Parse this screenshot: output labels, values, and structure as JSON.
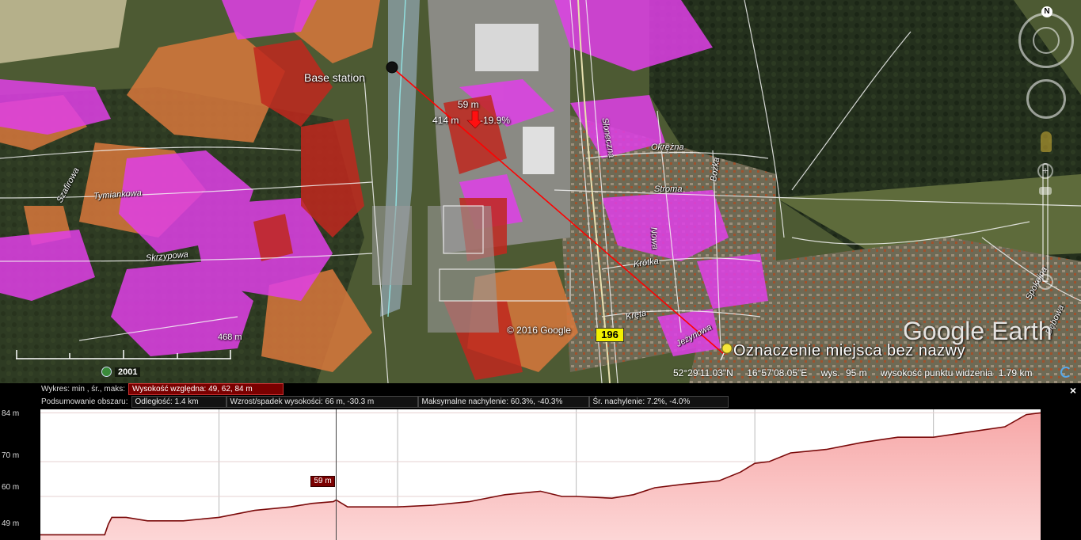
{
  "map": {
    "base_station_label": "Base station",
    "profile_point": {
      "elevation": "59 m",
      "distance": "414 m",
      "slope": "-19.9%"
    },
    "copyright": "© 2016 Google",
    "scale_label": "468 m",
    "placemark_label": "Oznaczenie miejsca bez nazwy",
    "logo": "Google Earth",
    "road_number": "196",
    "imagery_year": "2001",
    "streets": [
      {
        "name": "Szafirowa"
      },
      {
        "name": "Tymiankowa"
      },
      {
        "name": "Skrzypowa"
      },
      {
        "name": "Okrężna"
      },
      {
        "name": "Stroma"
      },
      {
        "name": "Krótka"
      },
      {
        "name": "Kręta"
      },
      {
        "name": "Jeżynowa"
      },
      {
        "name": "Spokojna"
      },
      {
        "name": "Słoneczna"
      },
      {
        "name": "Nowa"
      },
      {
        "name": "Bożka"
      },
      {
        "name": "Dębowa"
      }
    ],
    "status": {
      "latitude": "52°29'11.03\"N",
      "longitude": "16°57'08.05\"E",
      "elevation_label": "wys.",
      "elevation_value": "95 m",
      "eye_alt_label": "wysokość punktu widzenia",
      "eye_alt_value": "1.79 km"
    },
    "nav": {
      "north": "N",
      "zoom_in": "+",
      "zoom_out": "−"
    },
    "colors": {
      "coverage_magenta": "#e040e8",
      "coverage_orange": "#d8783c",
      "coverage_red": "#c0281e",
      "path_line": "#ff0000",
      "placemark": "#f5e53a"
    }
  },
  "profile": {
    "row1_label": "Wykres: min , śr., maks:",
    "row1_highlight": "Wysokość względna: 49, 62, 84 m",
    "row2_label": "Podsumowanie obszaru:",
    "row2_cells": [
      "Odległość: 1.4 km",
      "Wzrost/spadek wysokości: 66 m, -30.3 m",
      "Maksymalne nachylenie: 60.3%, -40.3%",
      "Śr. nachylenie: 7.2%, -4.0%"
    ],
    "close": "×",
    "y_ticks": [
      {
        "label": "84 m",
        "value": 84
      },
      {
        "label": "70 m",
        "value": 70
      },
      {
        "label": "60 m",
        "value": 60
      },
      {
        "label": "49 m",
        "value": 49
      }
    ],
    "cursor": {
      "label": "59 m",
      "distance_km": 0.414
    },
    "chart_data": {
      "type": "area",
      "ylim": [
        47.5,
        85
      ],
      "xlim": [
        0,
        1.4
      ],
      "x": [
        0,
        0.05,
        0.09,
        0.095,
        0.1,
        0.12,
        0.15,
        0.2,
        0.25,
        0.3,
        0.35,
        0.38,
        0.41,
        0.414,
        0.43,
        0.5,
        0.55,
        0.6,
        0.65,
        0.7,
        0.73,
        0.75,
        0.8,
        0.83,
        0.86,
        0.9,
        0.95,
        0.98,
        1.0,
        1.02,
        1.05,
        1.1,
        1.15,
        1.2,
        1.25,
        1.3,
        1.35,
        1.38,
        1.4
      ],
      "values": [
        49,
        49,
        49,
        52,
        54,
        54,
        53,
        53,
        54,
        56,
        57,
        58,
        58.5,
        59,
        57,
        57,
        57.5,
        58.5,
        60.5,
        61.5,
        60,
        60,
        59.5,
        60.5,
        62.5,
        63.5,
        64.5,
        67,
        69.5,
        70,
        72.5,
        73.5,
        75.5,
        77,
        77,
        78.5,
        80,
        83.5,
        84
      ]
    }
  }
}
